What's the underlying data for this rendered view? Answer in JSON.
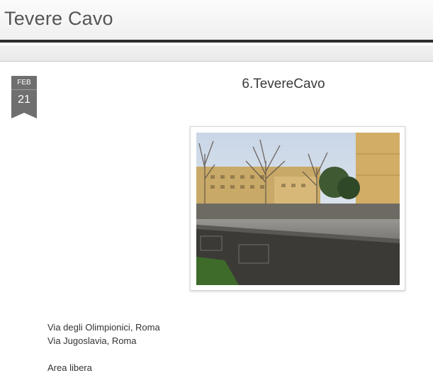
{
  "header": {
    "site_title": "Tevere Cavo"
  },
  "post": {
    "date": {
      "month": "FEB",
      "day": "21"
    },
    "title": "6.TevereCavo",
    "address_lines": [
      "Via degli Olimpionici, Roma",
      "Via Jugoslavia, Roma"
    ],
    "note": "Area libera"
  },
  "colors": {
    "header_border": "#2e2e2e",
    "badge": "#6f6f6f",
    "text": "#333333"
  }
}
